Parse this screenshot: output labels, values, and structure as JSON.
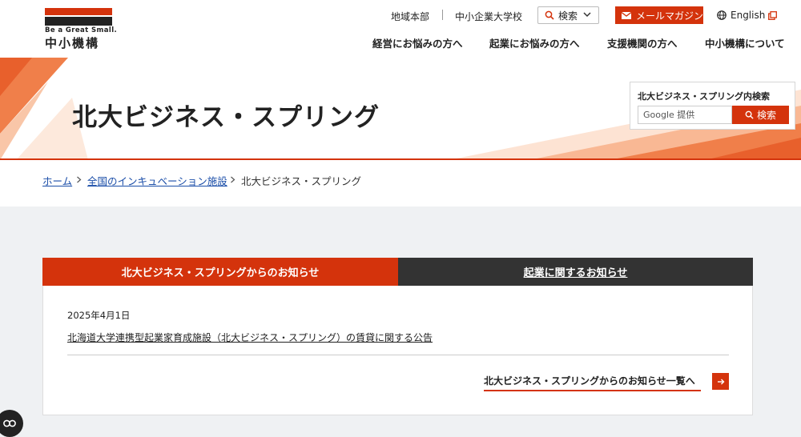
{
  "logo": {
    "tagline": "Be a Great Small.",
    "name": "中小機構"
  },
  "header": {
    "region_link": "地域本部",
    "university_link": "中小企業大学校",
    "search_label": "検索",
    "mail_label": "メールマガジン",
    "english_label": "English"
  },
  "nav": [
    {
      "label": "経営にお悩みの方へ"
    },
    {
      "label": "起業にお悩みの方へ"
    },
    {
      "label": "支援機関の方へ"
    },
    {
      "label": "中小機構について"
    }
  ],
  "hero": {
    "title": "北大ビジネス・スプリング"
  },
  "site_search": {
    "label": "北大ビジネス・スプリング内検索",
    "placeholder": "Google 提供",
    "button": "検索"
  },
  "breadcrumb": [
    {
      "label": "ホーム"
    },
    {
      "label": "全国のインキュベーション施設"
    },
    {
      "label": "北大ビジネス・スプリング"
    }
  ],
  "tabs": [
    {
      "label": "北大ビジネス・スプリングからのお知らせ"
    },
    {
      "label": "起業に関するお知らせ"
    }
  ],
  "news": {
    "date": "2025年4月1日",
    "title": "北海道大学連携型起業家育成施設（北大ビジネス・スプリング）の賃貸に関する公告",
    "more_label": "北大ビジネス・スプリングからのお知らせ一覧へ"
  },
  "colors": {
    "brand": "#d4330c",
    "dark": "#333333"
  },
  "icons": [
    "search-icon",
    "chevron-down-icon",
    "mail-icon",
    "globe-icon",
    "external-link-icon",
    "chevron-right-icon",
    "arrow-right-icon",
    "closed-caption-icon"
  ]
}
